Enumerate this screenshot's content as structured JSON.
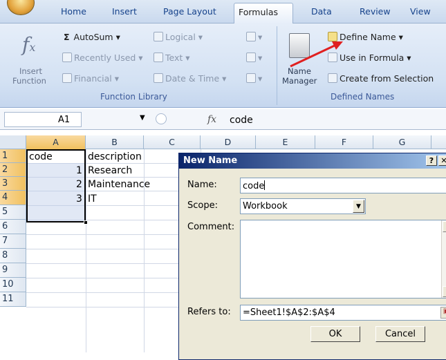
{
  "ribbon": {
    "tabs": [
      {
        "label": "Home"
      },
      {
        "label": "Insert"
      },
      {
        "label": "Page Layout"
      },
      {
        "label": "Formulas"
      },
      {
        "label": "Data"
      },
      {
        "label": "Review"
      },
      {
        "label": "View"
      }
    ],
    "active_tab": "Formulas",
    "function_library": {
      "label": "Function Library",
      "insert_function_line1": "Insert",
      "insert_function_line2": "Function",
      "autosum": "AutoSum ▾",
      "recently_used": "Recently Used ▾",
      "financial": "Financial ▾",
      "logical": "Logical ▾",
      "text": "Text ▾",
      "date_time": "Date & Time ▾"
    },
    "defined_names": {
      "label": "Defined Names",
      "name_manager_line1": "Name",
      "name_manager_line2": "Manager",
      "define_name": "Define Name ▾",
      "use_in_formula": "Use in Formula ▾",
      "create_from_selection": "Create from Selection"
    }
  },
  "formula_bar": {
    "name_box": "A1",
    "fx": "fx",
    "value": "code"
  },
  "grid": {
    "columns": [
      "A",
      "B",
      "C",
      "D",
      "E",
      "F",
      "G"
    ],
    "rows": [
      "1",
      "2",
      "3",
      "4",
      "5",
      "6",
      "7",
      "8",
      "9",
      "10",
      "11"
    ],
    "cells": {
      "a1": "code",
      "b1": "description",
      "a2": "1",
      "b2": "Research",
      "a3": "2",
      "b3": "Maintenance",
      "a4": "3",
      "b4": "IT"
    }
  },
  "dialog": {
    "title": "New Name",
    "help": "?",
    "close": "✕",
    "name_label": "Name:",
    "name_value": "code",
    "scope_label": "Scope:",
    "scope_value": "Workbook",
    "comment_label": "Comment:",
    "refers_label": "Refers to:",
    "refers_value": "=Sheet1!$A$2:$A$4",
    "ok": "OK",
    "cancel": "Cancel"
  },
  "colors": {
    "annotation_arrow": "#e02020",
    "dialog_title": "#0a246a",
    "tab_text": "#15428b"
  }
}
